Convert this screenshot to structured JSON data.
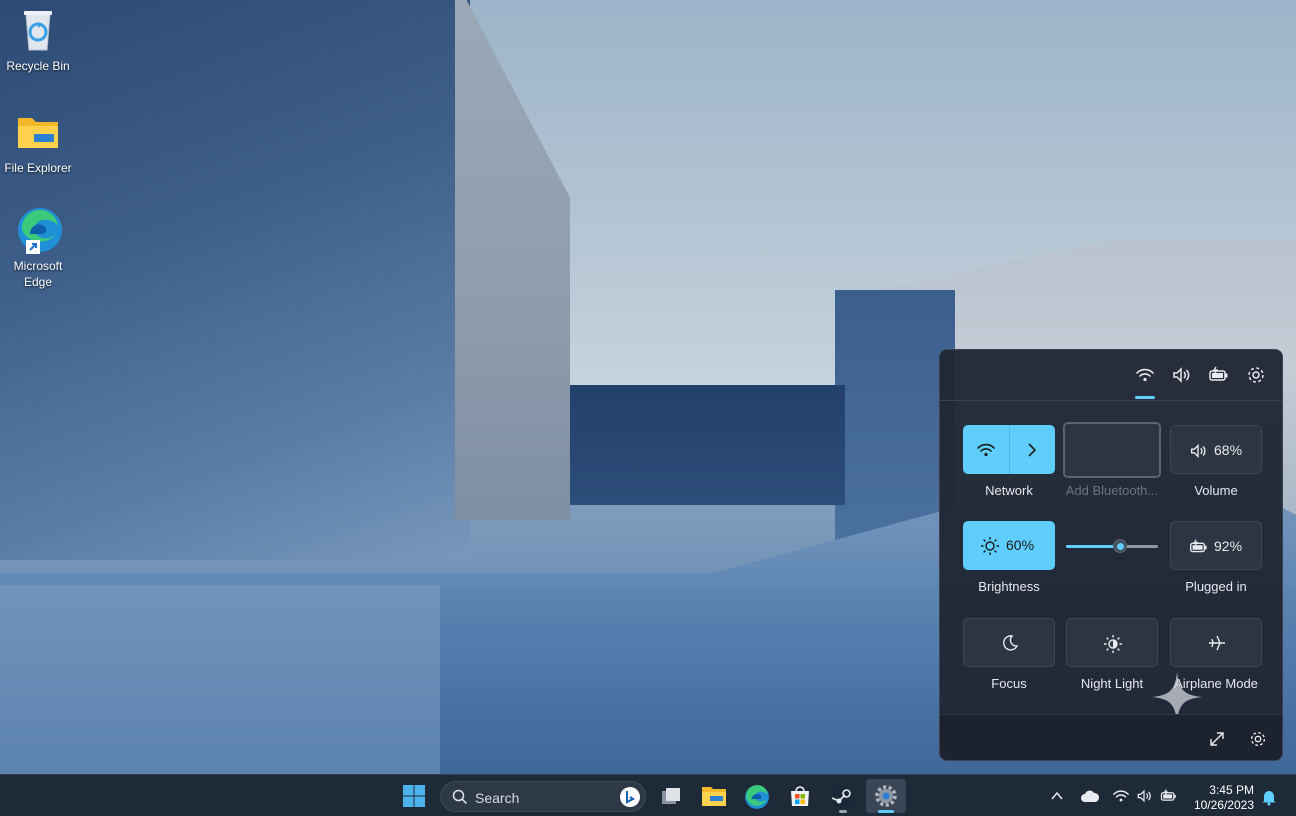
{
  "desktop": {
    "icons": [
      {
        "label": "Recycle Bin"
      },
      {
        "label": "File Explorer"
      },
      {
        "label": "Microsoft Edge"
      }
    ]
  },
  "quick_settings": {
    "tiles": {
      "network": {
        "label": "Network",
        "active": true
      },
      "bluetooth": {
        "label": "Add Bluetooth...",
        "active": false
      },
      "volume": {
        "label": "Volume",
        "value": "68%"
      },
      "brightness": {
        "label": "Brightness",
        "value": "60%",
        "active": true
      },
      "battery": {
        "label": "Plugged in",
        "value": "92%"
      },
      "focus": {
        "label": "Focus"
      },
      "night_light": {
        "label": "Night Light"
      },
      "airplane": {
        "label": "Airplane Mode"
      }
    },
    "slider_level": 0.6,
    "accent_color": "#60cdff"
  },
  "taskbar": {
    "search_placeholder": "Search",
    "clock_time": "3:45 PM",
    "clock_date": "10/26/2023",
    "apps": [
      "start-icon",
      "file-explorer-icon",
      "edge-icon",
      "store-icon",
      "steam-icon",
      "settings-icon"
    ]
  }
}
